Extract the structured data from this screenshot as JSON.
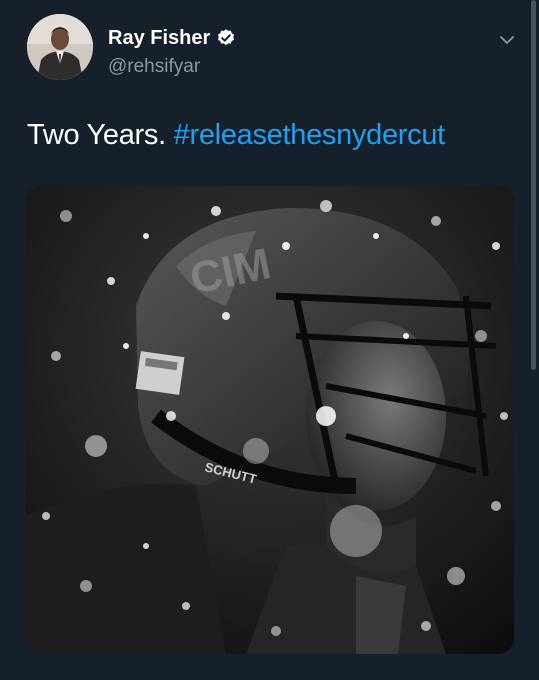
{
  "tweet": {
    "author": {
      "display_name": "Ray Fisher",
      "handle": "@rehsifyar",
      "verified": true
    },
    "text": "Two Years.",
    "hashtag": "#releasethesnydercut",
    "media": {
      "helmet_brand_text": "SCHUTT"
    }
  },
  "icons": {
    "verified": "verified-badge-icon",
    "more": "chevron-down-icon"
  },
  "colors": {
    "background": "#15202b",
    "text": "#ffffff",
    "secondary_text": "#8899a6",
    "accent": "#1da1f2"
  }
}
